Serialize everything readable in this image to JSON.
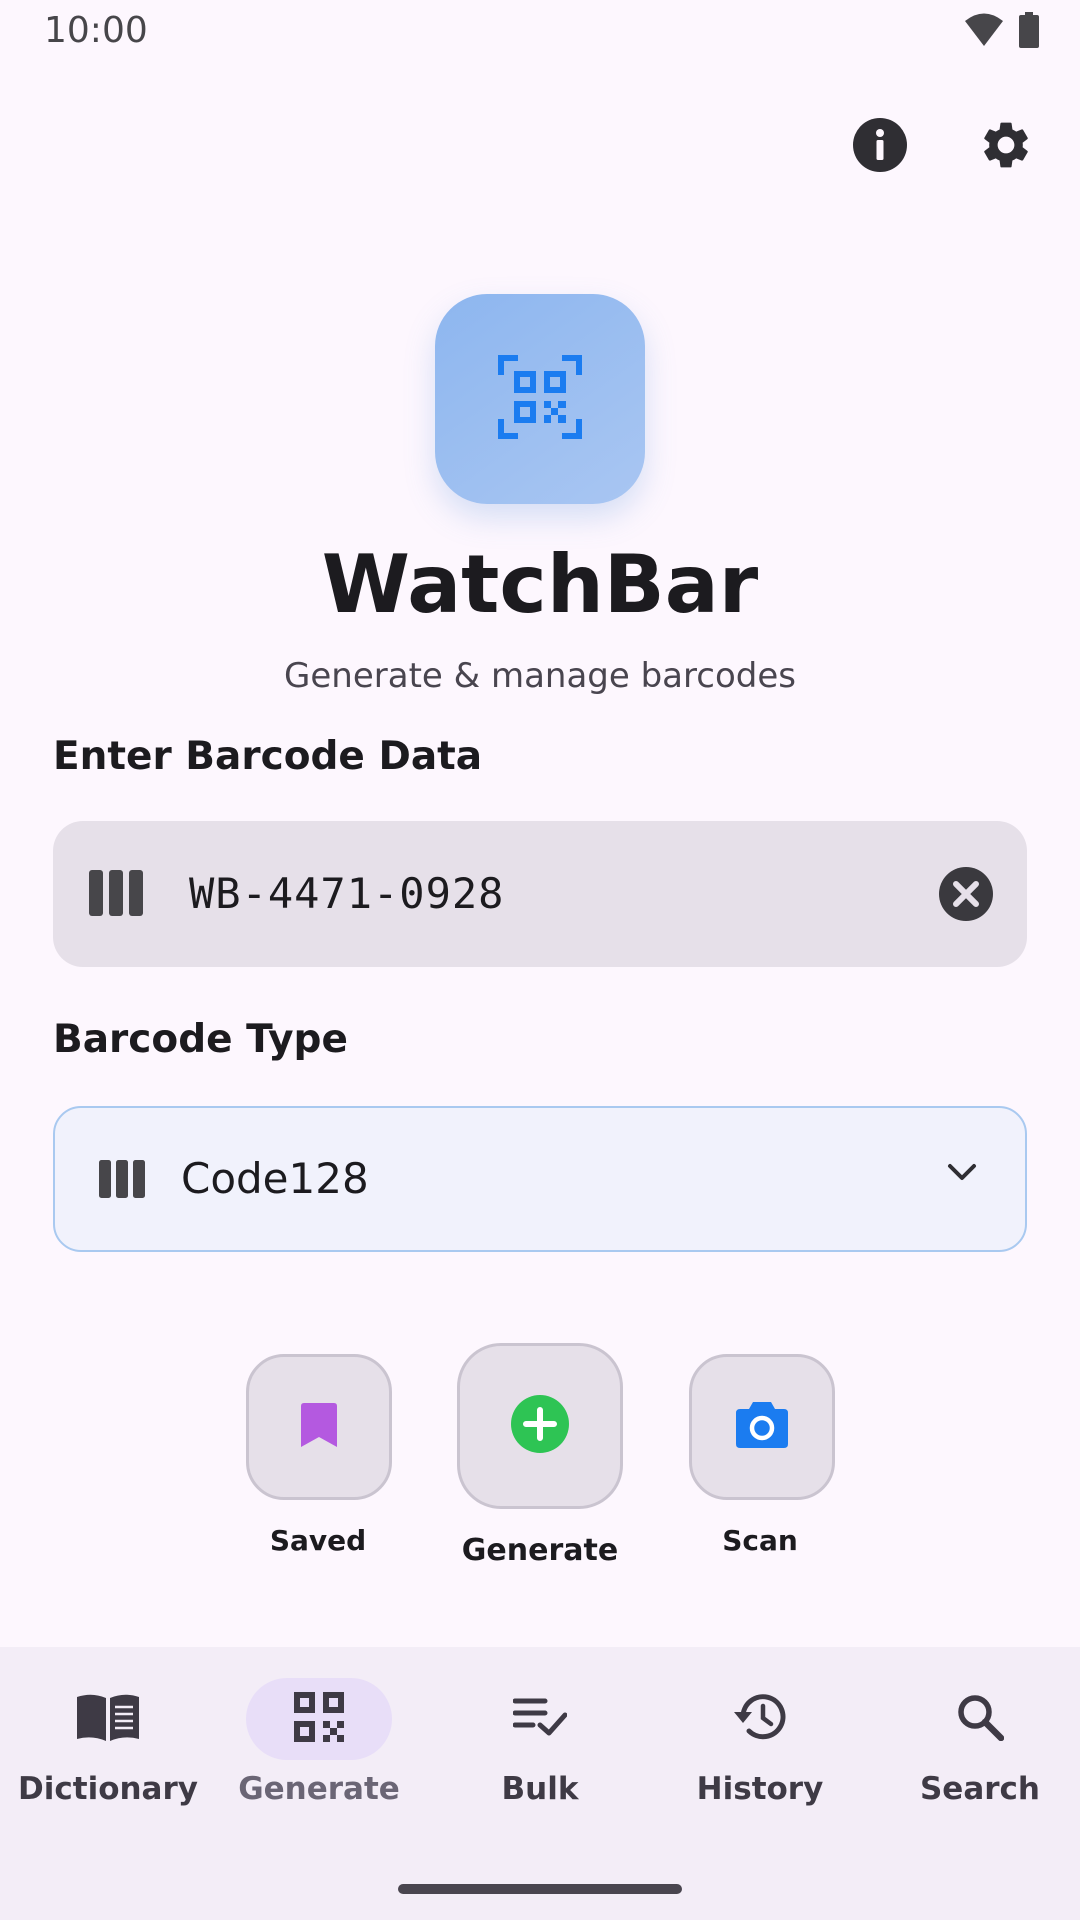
{
  "status_bar": {
    "time": "10:00",
    "icons": [
      "wifi-icon",
      "battery-icon"
    ]
  },
  "top_actions": {
    "info_icon": "info-icon",
    "settings_icon": "gear-icon"
  },
  "app": {
    "logo_icon": "qr-scan-icon",
    "title": "WatchBar",
    "subtitle": "Generate & manage barcodes"
  },
  "barcode_data": {
    "label": "Enter Barcode Data",
    "value": "WB-4471-0928",
    "lead_icon": "barcode-icon",
    "clear_icon": "clear-icon"
  },
  "barcode_type": {
    "label": "Barcode Type",
    "selected": "Code128",
    "lead_icon": "barcode-icon",
    "chevron_icon": "chevron-down-icon"
  },
  "actions": [
    {
      "label": "Saved",
      "icon": "bookmark-icon",
      "color": "#B459E0"
    },
    {
      "label": "Generate",
      "icon": "add-circle-icon",
      "color": "#2EC454"
    },
    {
      "label": "Scan",
      "icon": "camera-icon",
      "color": "#1B7CF0"
    }
  ],
  "bottom_nav": {
    "active": "Generate",
    "items": [
      {
        "label": "Dictionary",
        "icon": "book-icon"
      },
      {
        "label": "Generate",
        "icon": "qr-code-icon"
      },
      {
        "label": "Bulk",
        "icon": "playlist-check-icon"
      },
      {
        "label": "History",
        "icon": "history-icon"
      },
      {
        "label": "Search",
        "icon": "search-icon"
      }
    ]
  },
  "colors": {
    "background": "#FDF7FE",
    "accent_blue": "#1B7CF0",
    "nav_active_pill": "#E8DEF8"
  }
}
